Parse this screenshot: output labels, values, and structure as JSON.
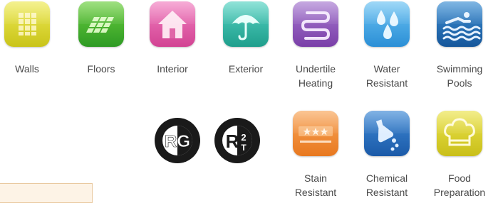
{
  "features": [
    {
      "label": "Walls",
      "icon": "tile-grid-icon",
      "color": "#d7d62a"
    },
    {
      "label": "Floors",
      "icon": "floor-tiles-icon",
      "color": "#3fae32"
    },
    {
      "label": "Interior",
      "icon": "house-icon",
      "color": "#e45ea6"
    },
    {
      "label": "Exterior",
      "icon": "umbrella-icon",
      "color": "#2bb7a4"
    },
    {
      "label": "Undertile\nHeating",
      "icon": "heating-coil-icon",
      "color": "#8d54b8"
    },
    {
      "label": "Water\nResistant",
      "icon": "water-drops-icon",
      "color": "#3aa6e6"
    },
    {
      "label": "Swimming\nPools",
      "icon": "swimmer-icon",
      "color": "#1c6fb5"
    },
    {
      "label": "Stain\nResistant",
      "icon": "stars-icon",
      "color": "#f39133"
    },
    {
      "label": "Chemical\nResistant",
      "icon": "flask-pour-icon",
      "color": "#2870c4"
    },
    {
      "label": "Food\nPreparation",
      "icon": "chef-hat-icon",
      "color": "#d9cf25"
    }
  ],
  "badges": [
    {
      "text": "RG",
      "icon": "rg-certification-badge"
    },
    {
      "text": "R2T",
      "main": "R",
      "top": "2",
      "bottom": "T",
      "icon": "r2t-certification-badge"
    }
  ]
}
